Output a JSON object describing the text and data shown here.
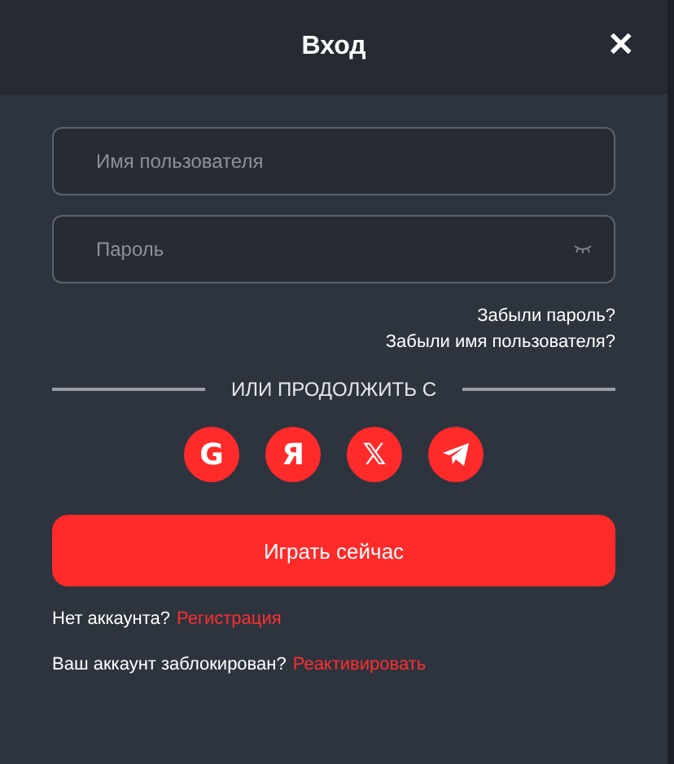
{
  "window": {
    "title": "Вход",
    "close": "✕"
  },
  "fields": [
    {
      "placeholder": "Имя пользователя",
      "kind": "text"
    },
    {
      "placeholder": "Пароль",
      "kind": "password"
    }
  ],
  "links": [
    "Забыли пароль?",
    "Забыли имя пользователя?"
  ],
  "divider": "ИЛИ ПРОДОЛЖИТЬ С",
  "social": [
    {
      "kind": "letter",
      "text": "G"
    },
    {
      "kind": "letter",
      "text": "Я"
    },
    {
      "kind": "letter",
      "text": "𝕏"
    },
    {
      "kind": "telegram"
    }
  ],
  "primary_button": "Играть сейчас",
  "footer": [
    {
      "text": "Нет аккаунта?",
      "link": "Регистрация"
    },
    {
      "text": "Ваш аккаунт заблокирован?",
      "link": "Реактивировать"
    }
  ]
}
